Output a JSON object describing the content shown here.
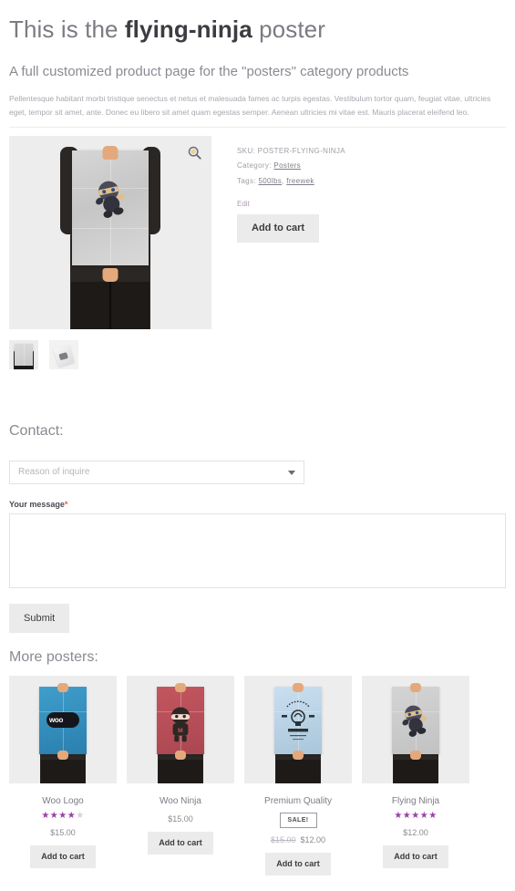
{
  "header": {
    "title_pre": "This is the ",
    "title_strong": "flying-ninja",
    "title_post": " poster",
    "subtitle": "A full customized product page for the \"posters\" category products",
    "description": "Pellentesque habitant morbi tristique senectus et netus et malesuada fames ac turpis egestas. Vestibulum tortor quam, feugiat vitae, ultricies eget, tempor sit amet, ante. Donec eu libero sit amet quam egestas semper. Aenean ultricies mi vitae est. Mauris placerat eleifend leo."
  },
  "gallery": {
    "zoom_icon": "magnifier-zoom-icon",
    "main_alt": "flying-ninja poster held by a person",
    "thumbs": [
      {
        "name": "thumbnail-1",
        "alt": "flying-ninja poster front"
      },
      {
        "name": "thumbnail-2",
        "alt": "flying-ninja poster angled"
      }
    ]
  },
  "summary": {
    "sku_label": "SKU:",
    "sku_value": "POSTER-FLYING-NINJA",
    "category_label": "Category:",
    "category_value": "Posters",
    "tags_label": "Tags:",
    "tags": [
      "500lbs",
      "freewek"
    ],
    "tags_separator": ", ",
    "edit_label": "Edit",
    "add_to_cart_label": "Add to cart"
  },
  "contact": {
    "heading": "Contact:",
    "select": {
      "value": "Reason of inquire",
      "placeholder": "Reason of inquire",
      "options": [
        "Reason of inquire"
      ]
    },
    "message_label": "Your message",
    "required_marker": "*",
    "message_value": "",
    "message_placeholder": "",
    "submit_label": "Submit"
  },
  "more_posters": {
    "heading": "More posters:",
    "add_to_cart_label": "Add to cart",
    "sale_label": "SALE!",
    "products": [
      {
        "title": "Woo Logo",
        "rating": 4,
        "max_rating": 5,
        "price": "$15.00",
        "old_price": "",
        "on_sale": false,
        "poster_color": "#2f8fc0",
        "poster_art": "woo"
      },
      {
        "title": "Woo Ninja",
        "rating": 0,
        "max_rating": 5,
        "price": "$15.00",
        "old_price": "",
        "on_sale": false,
        "poster_color": "#b9515b",
        "poster_art": "ninja-red"
      },
      {
        "title": "Premium Quality",
        "rating": 0,
        "max_rating": 5,
        "price": "$12.00",
        "old_price": "$15.00",
        "on_sale": true,
        "poster_color": "#b5cede",
        "poster_art": "badge"
      },
      {
        "title": "Flying Ninja",
        "rating": 5,
        "max_rating": 5,
        "price": "$12.00",
        "old_price": "",
        "on_sale": false,
        "poster_color": "#c9c9c9",
        "poster_art": "ninja-grey"
      }
    ]
  },
  "colors": {
    "heading": "#8a8a92",
    "accent_star": "#9b3fa8",
    "button_bg": "#ebebeb",
    "required": "#ff4d4d",
    "image_bg": "#ededed"
  }
}
